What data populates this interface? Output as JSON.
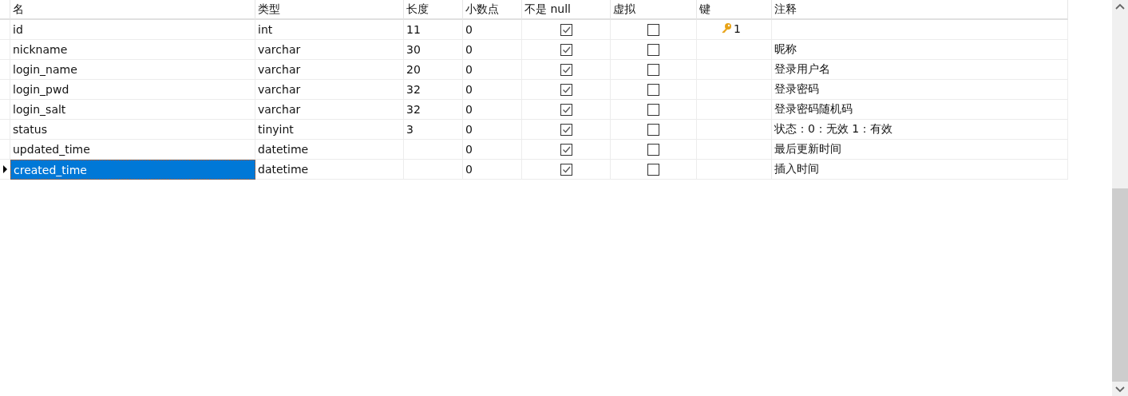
{
  "table": {
    "columns": [
      "名",
      "类型",
      "长度",
      "小数点",
      "不是 null",
      "虚拟",
      "键",
      "注释"
    ],
    "rows": [
      {
        "name": "id",
        "type": "int",
        "length": "11",
        "decimals": "0",
        "not_null": true,
        "virtual": false,
        "key": "1",
        "selected": false
      },
      {
        "name": "nickname",
        "type": "varchar",
        "length": "30",
        "decimals": "0",
        "not_null": true,
        "virtual": false,
        "comment": "昵称",
        "selected": false
      },
      {
        "name": "login_name",
        "type": "varchar",
        "length": "20",
        "decimals": "0",
        "not_null": true,
        "virtual": false,
        "comment": "登录用户名",
        "selected": false
      },
      {
        "name": "login_pwd",
        "type": "varchar",
        "length": "32",
        "decimals": "0",
        "not_null": true,
        "virtual": false,
        "comment": "登录密码",
        "selected": false
      },
      {
        "name": "login_salt",
        "type": "varchar",
        "length": "32",
        "decimals": "0",
        "not_null": true,
        "virtual": false,
        "comment": "登录密码随机码",
        "selected": false
      },
      {
        "name": "status",
        "type": "tinyint",
        "length": "3",
        "decimals": "0",
        "not_null": true,
        "virtual": false,
        "comment": "状态：0：无效 1：有效",
        "selected": false
      },
      {
        "name": "updated_time",
        "type": "datetime",
        "decimals": "0",
        "not_null": true,
        "virtual": false,
        "comment": "最后更新时间",
        "selected": false
      },
      {
        "name": "created_time",
        "type": "datetime",
        "decimals": "0",
        "not_null": true,
        "virtual": false,
        "comment": "插入时间",
        "selected": true
      }
    ]
  }
}
